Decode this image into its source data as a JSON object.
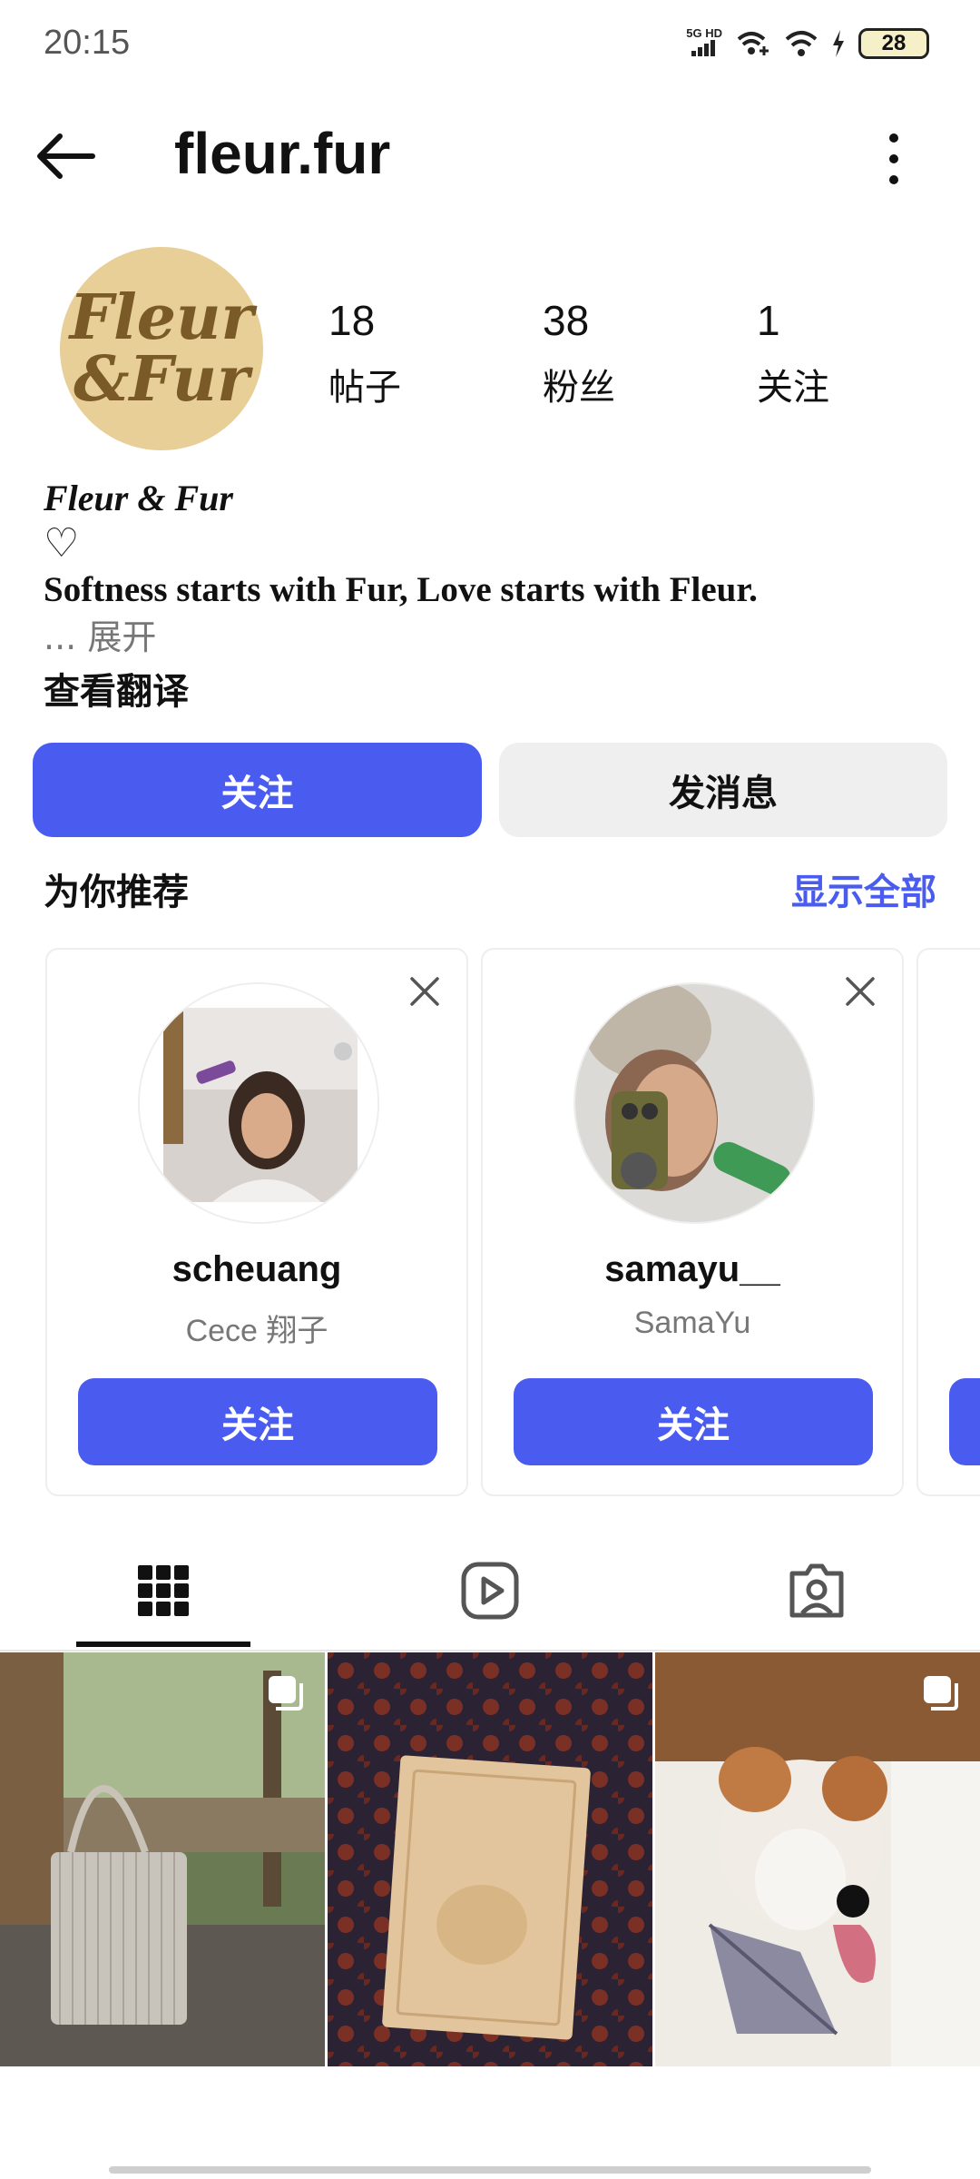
{
  "status_bar": {
    "time": "20:15",
    "network": "5G HD",
    "battery": "28",
    "icons": [
      "signal-icon",
      "wifi-plus-icon",
      "wifi-icon",
      "charging-icon",
      "battery-icon"
    ]
  },
  "header": {
    "back_icon": "arrow-left-icon",
    "title": "fleur.fur",
    "menu_icon": "more-vertical-icon"
  },
  "profile": {
    "avatar_logo": "Fleur & Fur",
    "stats": [
      {
        "value": "18",
        "label": "帖子"
      },
      {
        "value": "38",
        "label": "粉丝"
      },
      {
        "value": "1",
        "label": "关注"
      }
    ],
    "bio": {
      "name": "Fleur & Fur",
      "heart": "♡",
      "line": "Softness starts with Fur, Love starts with Fleur.",
      "more": "... 展开",
      "translate": "查看翻译"
    }
  },
  "actions": {
    "follow_label": "关注",
    "message_label": "发消息"
  },
  "suggestions": {
    "title": "为你推荐",
    "show_all": "显示全部",
    "cards": [
      {
        "username": "scheuang",
        "name": "Cece 翔子",
        "follow_label": "关注"
      },
      {
        "username": "samayu__",
        "name": "SamaYu",
        "follow_label": "关注"
      }
    ]
  },
  "tabs": [
    {
      "name": "grid-icon",
      "active": true
    },
    {
      "name": "reels-icon",
      "active": false
    },
    {
      "name": "tagged-icon",
      "active": false
    }
  ],
  "posts": [
    {
      "type": "multi",
      "subject": "striped tote bag in park"
    },
    {
      "type": "single",
      "subject": "Fleur & Fur box on patterned fabric"
    },
    {
      "type": "multi",
      "subject": "terrier dog with striped bandana"
    }
  ],
  "colors": {
    "accent": "#4a5cf0",
    "secondary_button": "#efefef",
    "avatar_bg": "#e7cf97",
    "text_muted": "#777777"
  }
}
